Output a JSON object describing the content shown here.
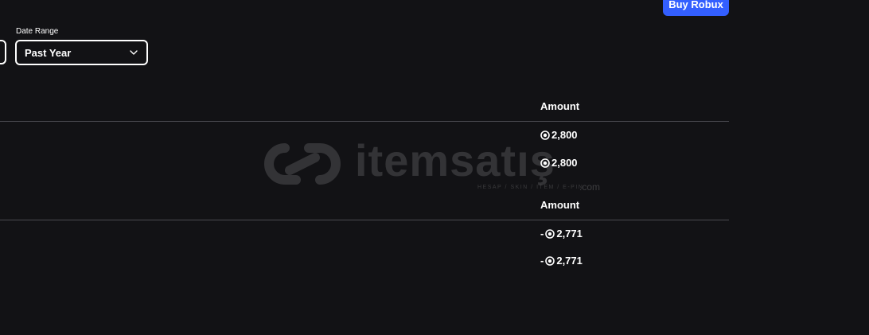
{
  "header": {
    "buy_label": "Buy Robux"
  },
  "filters": {
    "date_range_label": "Date Range",
    "date_range_value": "Past Year"
  },
  "tables": [
    {
      "header": "Amount",
      "rows": [
        {
          "amount": "2,800"
        },
        {
          "amount": "2,800"
        }
      ]
    },
    {
      "header": "Amount",
      "rows": [
        {
          "amount": "-",
          "value": "2,771"
        },
        {
          "amount": "-",
          "value": "2,771"
        }
      ]
    }
  ],
  "watermark": {
    "brand": "itemsatış",
    "tagline": "HESAP / SKIN / ITEM / E-PIN",
    "domain": ".com"
  },
  "icons": {
    "robux": "robux-icon",
    "chevron": "chevron-down-icon"
  },
  "colors": {
    "background": "#121215",
    "accent": "#335fff",
    "divider": "#4a4a50"
  }
}
